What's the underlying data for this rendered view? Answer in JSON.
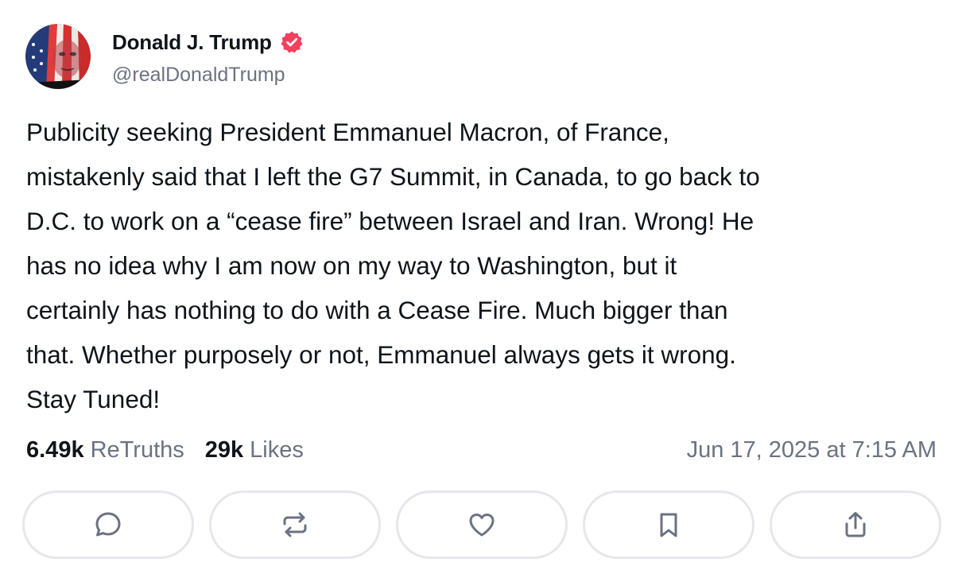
{
  "author": {
    "display_name": "Donald J. Trump",
    "handle": "@realDonaldTrump",
    "verified_badge_icon": "verified-badge-icon",
    "verified_color": "#f43f5e"
  },
  "post": {
    "lines": [
      "Publicity seeking President Emmanuel Macron, of France,",
      "mistakenly said that I left the G7 Summit, in Canada, to go back to",
      "D.C. to work on a “cease fire” between Israel and Iran. Wrong! He",
      "has no idea why I am now on my way to Washington, but it",
      "certainly has nothing to do with a Cease Fire. Much bigger than",
      "that. Whether purposely or not, Emmanuel always gets it wrong.",
      "Stay Tuned!"
    ]
  },
  "stats": {
    "retruths_count": "6.49k",
    "retruths_label": "ReTruths",
    "likes_count": "29k",
    "likes_label": "Likes"
  },
  "timestamp": "Jun 17, 2025 at 7:15 AM",
  "actions": [
    {
      "name": "reply",
      "icon": "comment-icon"
    },
    {
      "name": "retruth",
      "icon": "repost-icon"
    },
    {
      "name": "like",
      "icon": "heart-icon"
    },
    {
      "name": "bookmark",
      "icon": "bookmark-icon"
    },
    {
      "name": "share",
      "icon": "share-icon"
    }
  ],
  "colors": {
    "text_primary": "#0f1419",
    "text_secondary": "#6b7280",
    "button_border": "#e5e7eb",
    "icon_color": "#6b7280"
  }
}
